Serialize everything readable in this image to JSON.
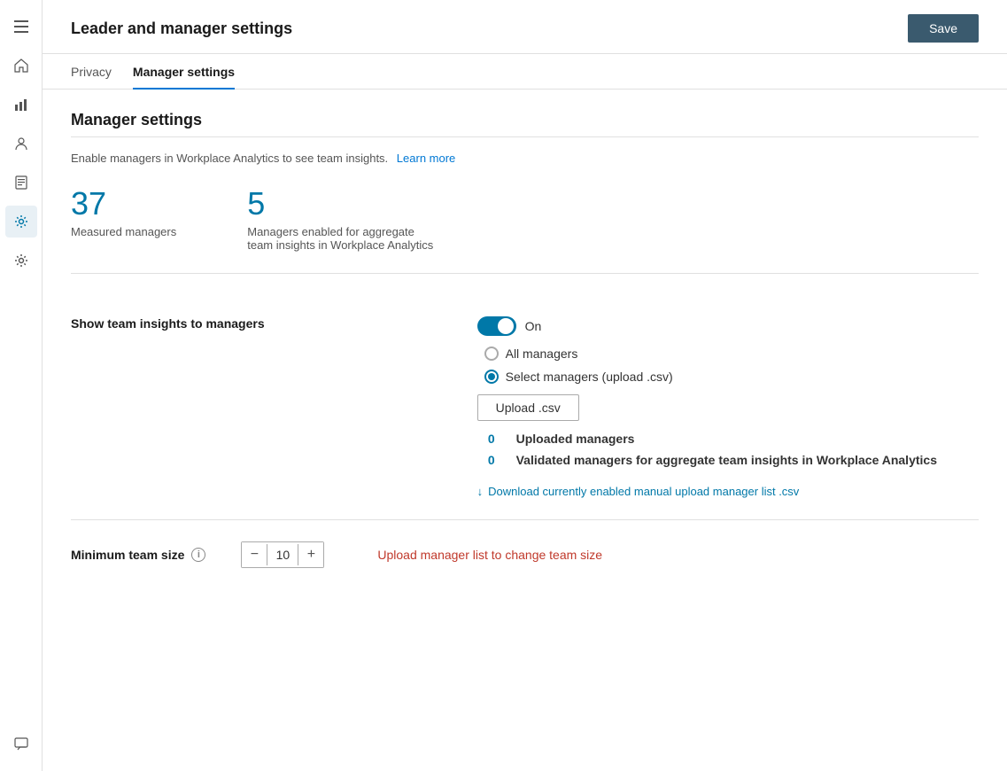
{
  "header": {
    "title": "Leader and manager settings",
    "save_button": "Save"
  },
  "tabs": [
    {
      "id": "privacy",
      "label": "Privacy",
      "active": false
    },
    {
      "id": "manager-settings",
      "label": "Manager settings",
      "active": true
    }
  ],
  "manager_settings": {
    "section_title": "Manager settings",
    "description": "Enable managers in Workplace Analytics to see team insights.",
    "learn_more": "Learn more",
    "stats": [
      {
        "number": "37",
        "label": "Measured managers"
      },
      {
        "number": "5",
        "label": "Managers enabled for aggregate team insights in Workplace Analytics"
      }
    ],
    "show_team_insights": {
      "label": "Show team insights to managers",
      "toggle_state": "On",
      "toggle_on": true
    },
    "radio_options": [
      {
        "id": "all-managers",
        "label": "All managers",
        "checked": false
      },
      {
        "id": "select-managers",
        "label": "Select managers (upload .csv)",
        "checked": true
      }
    ],
    "upload_button": "Upload .csv",
    "upload_stats": [
      {
        "number": "0",
        "label": "Uploaded managers"
      },
      {
        "number": "0",
        "label": "Validated managers for aggregate team insights in Workplace Analytics"
      }
    ],
    "download_link": "Download currently enabled manual upload manager list .csv",
    "minimum_team_size": {
      "label": "Minimum team size",
      "value": "10",
      "upload_change_label": "Upload manager list to change team size"
    }
  },
  "sidebar": {
    "icons": [
      {
        "id": "menu",
        "symbol": "☰",
        "active": false
      },
      {
        "id": "home",
        "symbol": "⌂",
        "active": false
      },
      {
        "id": "chart",
        "symbol": "📊",
        "active": false
      },
      {
        "id": "people",
        "symbol": "👤",
        "active": false
      },
      {
        "id": "reports",
        "symbol": "📋",
        "active": false
      },
      {
        "id": "settings",
        "symbol": "⚙",
        "active": true
      },
      {
        "id": "settings2",
        "symbol": "⚙",
        "active": false
      }
    ],
    "bottom": [
      {
        "id": "feedback",
        "symbol": "💬"
      }
    ]
  }
}
